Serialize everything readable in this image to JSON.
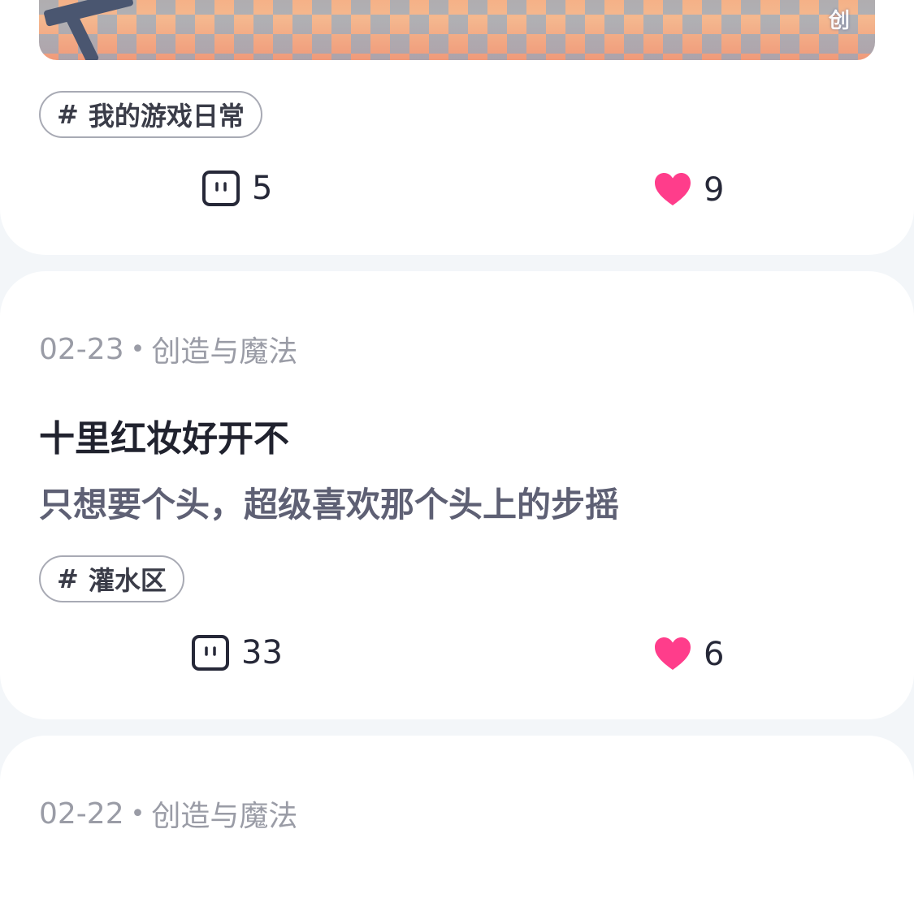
{
  "posts": [
    {
      "tag": "我的游戏日常",
      "tag_symbol": "#",
      "comments": "5",
      "likes": "9"
    },
    {
      "date": "02-23",
      "separator": "•",
      "category": "创造与魔法",
      "title": "十里红妆好开不",
      "body": "只想要个头，超级喜欢那个头上的步摇",
      "tag": "灌水区",
      "tag_symbol": "#",
      "comments": "33",
      "likes": "6"
    },
    {
      "date": "02-22",
      "separator": "•",
      "category": "创造与魔法"
    }
  ],
  "icons": {
    "comment": "comment-icon",
    "like": "heart-icon"
  },
  "colors": {
    "background": "#f3f6f9",
    "card": "#ffffff",
    "heart": "#ff3d8b",
    "meta_text": "#9a9ca6",
    "title_text": "#20222e",
    "body_text": "#5e6074"
  }
}
